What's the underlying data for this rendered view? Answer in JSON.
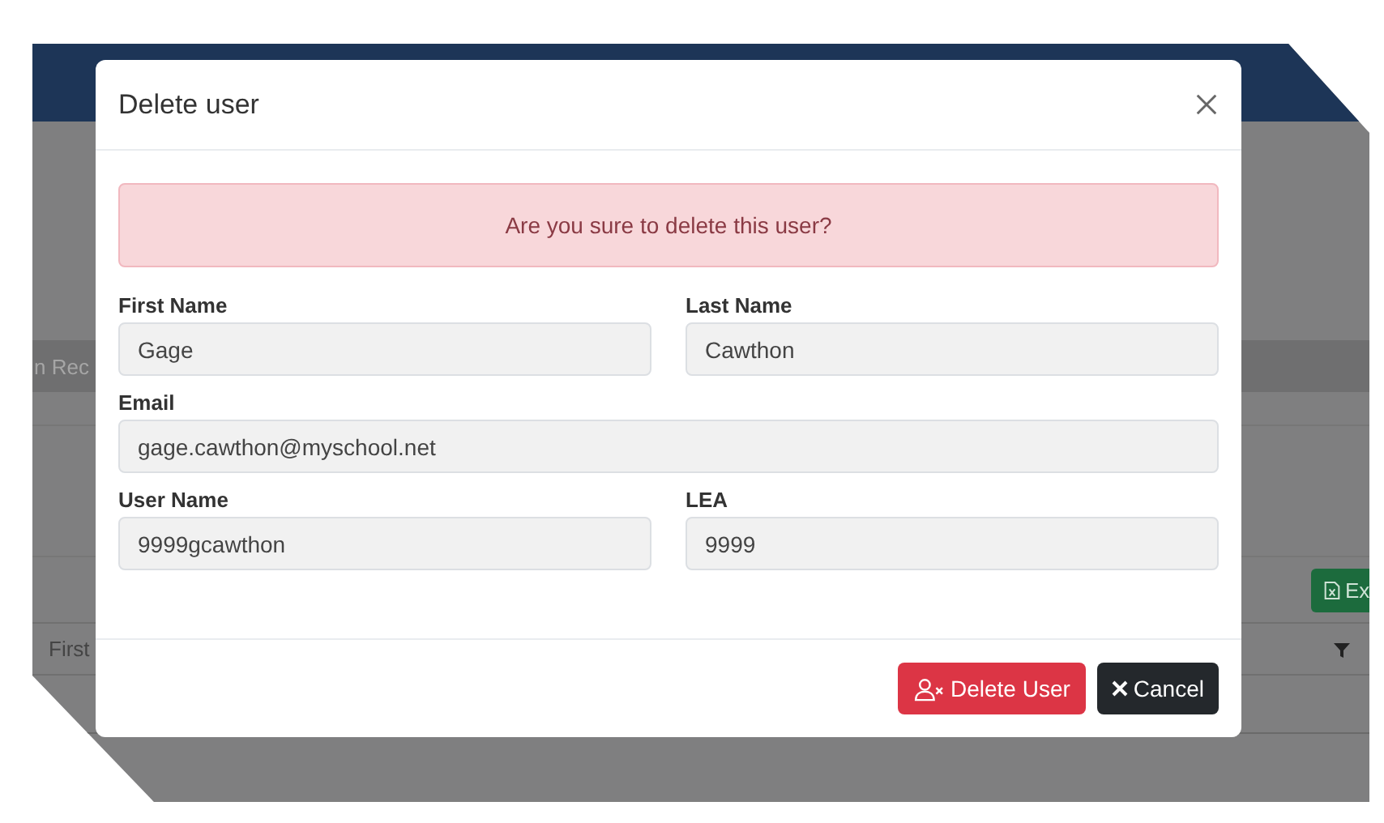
{
  "background": {
    "tab": "n Rec",
    "export_button": "Ex",
    "table_header": "First"
  },
  "modal": {
    "title": "Delete user",
    "alert": "Are you sure to delete this user?",
    "field_rows": [
      [
        {
          "label": "First Name",
          "value": "Gage"
        },
        {
          "label": "Last Name",
          "value": "Cawthon"
        }
      ],
      [
        {
          "label": "Email",
          "value": "gage.cawthon@myschool.net"
        }
      ],
      [
        {
          "label": "User Name",
          "value": "9999gcawthon"
        },
        {
          "label": "LEA",
          "value": "9999"
        }
      ]
    ],
    "buttons": [
      {
        "label": "Delete User",
        "kind": "danger"
      },
      {
        "label": "Cancel",
        "kind": "secondary"
      }
    ]
  }
}
